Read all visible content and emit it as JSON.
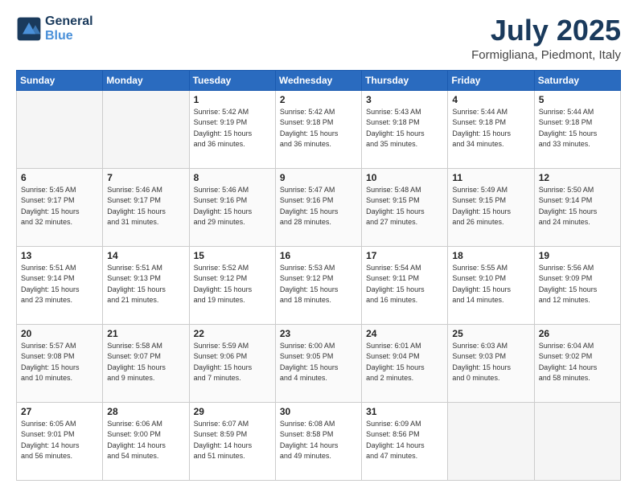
{
  "header": {
    "logo_line1": "General",
    "logo_line2": "Blue",
    "month": "July 2025",
    "location": "Formigliana, Piedmont, Italy"
  },
  "days_of_week": [
    "Sunday",
    "Monday",
    "Tuesday",
    "Wednesday",
    "Thursday",
    "Friday",
    "Saturday"
  ],
  "weeks": [
    [
      {
        "day": "",
        "info": ""
      },
      {
        "day": "",
        "info": ""
      },
      {
        "day": "1",
        "info": "Sunrise: 5:42 AM\nSunset: 9:19 PM\nDaylight: 15 hours\nand 36 minutes."
      },
      {
        "day": "2",
        "info": "Sunrise: 5:42 AM\nSunset: 9:18 PM\nDaylight: 15 hours\nand 36 minutes."
      },
      {
        "day": "3",
        "info": "Sunrise: 5:43 AM\nSunset: 9:18 PM\nDaylight: 15 hours\nand 35 minutes."
      },
      {
        "day": "4",
        "info": "Sunrise: 5:44 AM\nSunset: 9:18 PM\nDaylight: 15 hours\nand 34 minutes."
      },
      {
        "day": "5",
        "info": "Sunrise: 5:44 AM\nSunset: 9:18 PM\nDaylight: 15 hours\nand 33 minutes."
      }
    ],
    [
      {
        "day": "6",
        "info": "Sunrise: 5:45 AM\nSunset: 9:17 PM\nDaylight: 15 hours\nand 32 minutes."
      },
      {
        "day": "7",
        "info": "Sunrise: 5:46 AM\nSunset: 9:17 PM\nDaylight: 15 hours\nand 31 minutes."
      },
      {
        "day": "8",
        "info": "Sunrise: 5:46 AM\nSunset: 9:16 PM\nDaylight: 15 hours\nand 29 minutes."
      },
      {
        "day": "9",
        "info": "Sunrise: 5:47 AM\nSunset: 9:16 PM\nDaylight: 15 hours\nand 28 minutes."
      },
      {
        "day": "10",
        "info": "Sunrise: 5:48 AM\nSunset: 9:15 PM\nDaylight: 15 hours\nand 27 minutes."
      },
      {
        "day": "11",
        "info": "Sunrise: 5:49 AM\nSunset: 9:15 PM\nDaylight: 15 hours\nand 26 minutes."
      },
      {
        "day": "12",
        "info": "Sunrise: 5:50 AM\nSunset: 9:14 PM\nDaylight: 15 hours\nand 24 minutes."
      }
    ],
    [
      {
        "day": "13",
        "info": "Sunrise: 5:51 AM\nSunset: 9:14 PM\nDaylight: 15 hours\nand 23 minutes."
      },
      {
        "day": "14",
        "info": "Sunrise: 5:51 AM\nSunset: 9:13 PM\nDaylight: 15 hours\nand 21 minutes."
      },
      {
        "day": "15",
        "info": "Sunrise: 5:52 AM\nSunset: 9:12 PM\nDaylight: 15 hours\nand 19 minutes."
      },
      {
        "day": "16",
        "info": "Sunrise: 5:53 AM\nSunset: 9:12 PM\nDaylight: 15 hours\nand 18 minutes."
      },
      {
        "day": "17",
        "info": "Sunrise: 5:54 AM\nSunset: 9:11 PM\nDaylight: 15 hours\nand 16 minutes."
      },
      {
        "day": "18",
        "info": "Sunrise: 5:55 AM\nSunset: 9:10 PM\nDaylight: 15 hours\nand 14 minutes."
      },
      {
        "day": "19",
        "info": "Sunrise: 5:56 AM\nSunset: 9:09 PM\nDaylight: 15 hours\nand 12 minutes."
      }
    ],
    [
      {
        "day": "20",
        "info": "Sunrise: 5:57 AM\nSunset: 9:08 PM\nDaylight: 15 hours\nand 10 minutes."
      },
      {
        "day": "21",
        "info": "Sunrise: 5:58 AM\nSunset: 9:07 PM\nDaylight: 15 hours\nand 9 minutes."
      },
      {
        "day": "22",
        "info": "Sunrise: 5:59 AM\nSunset: 9:06 PM\nDaylight: 15 hours\nand 7 minutes."
      },
      {
        "day": "23",
        "info": "Sunrise: 6:00 AM\nSunset: 9:05 PM\nDaylight: 15 hours\nand 4 minutes."
      },
      {
        "day": "24",
        "info": "Sunrise: 6:01 AM\nSunset: 9:04 PM\nDaylight: 15 hours\nand 2 minutes."
      },
      {
        "day": "25",
        "info": "Sunrise: 6:03 AM\nSunset: 9:03 PM\nDaylight: 15 hours\nand 0 minutes."
      },
      {
        "day": "26",
        "info": "Sunrise: 6:04 AM\nSunset: 9:02 PM\nDaylight: 14 hours\nand 58 minutes."
      }
    ],
    [
      {
        "day": "27",
        "info": "Sunrise: 6:05 AM\nSunset: 9:01 PM\nDaylight: 14 hours\nand 56 minutes."
      },
      {
        "day": "28",
        "info": "Sunrise: 6:06 AM\nSunset: 9:00 PM\nDaylight: 14 hours\nand 54 minutes."
      },
      {
        "day": "29",
        "info": "Sunrise: 6:07 AM\nSunset: 8:59 PM\nDaylight: 14 hours\nand 51 minutes."
      },
      {
        "day": "30",
        "info": "Sunrise: 6:08 AM\nSunset: 8:58 PM\nDaylight: 14 hours\nand 49 minutes."
      },
      {
        "day": "31",
        "info": "Sunrise: 6:09 AM\nSunset: 8:56 PM\nDaylight: 14 hours\nand 47 minutes."
      },
      {
        "day": "",
        "info": ""
      },
      {
        "day": "",
        "info": ""
      }
    ]
  ]
}
